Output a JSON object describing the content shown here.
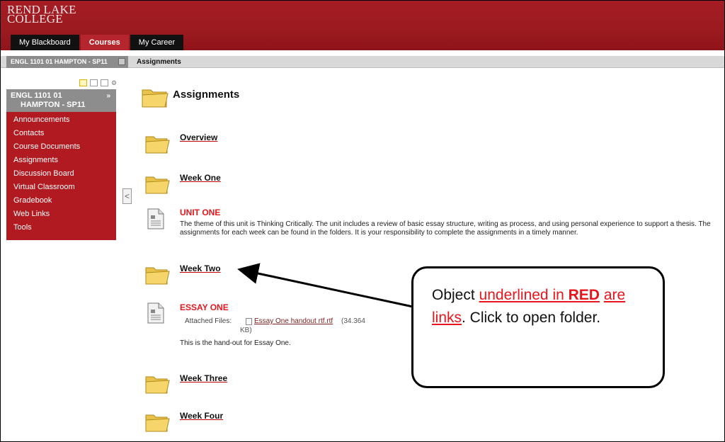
{
  "header": {
    "logo_line1": "REND LAKE",
    "logo_line2": "COLLEGE",
    "tabs": [
      {
        "label": "My Blackboard"
      },
      {
        "label": "Courses"
      },
      {
        "label": "My Career"
      }
    ],
    "active_tab": "Courses"
  },
  "breadcrumb": {
    "course": "ENGL 1101 01 HAMPTON - SP11",
    "current": "Assignments"
  },
  "course_menu": {
    "title_line1": "ENGL 1101 01",
    "title_line2": "HAMPTON - SP11",
    "arrows": "»",
    "items": [
      {
        "label": "Announcements"
      },
      {
        "label": "Contacts"
      },
      {
        "label": "Course Documents"
      },
      {
        "label": "Assignments"
      },
      {
        "label": "Discussion Board"
      },
      {
        "label": "Virtual Classroom"
      },
      {
        "label": "Gradebook"
      },
      {
        "label": "Web Links"
      },
      {
        "label": "Tools"
      }
    ],
    "collapse_glyph": "<"
  },
  "content": {
    "page_title": "Assignments",
    "items": [
      {
        "type": "folder",
        "title": "Overview"
      },
      {
        "type": "folder",
        "title": "Week One"
      },
      {
        "type": "item",
        "title": "UNIT ONE",
        "description": "The theme of this unit is Thinking Critically.  The unit includes a review of basic essay structure, writing as process, and using personal experience to support a thesis.  The assignments for each week can be found in the folders.  It is your responsibility to complete the assignments in a timely manner."
      },
      {
        "type": "folder",
        "title": "Week Two"
      },
      {
        "type": "item",
        "title": "ESSAY ONE",
        "attached_label": "Attached Files:",
        "attachment_name": "Essay One handout rtf.rtf",
        "attachment_size_a": "(34.364",
        "attachment_size_b": "KB)",
        "description": "This is the hand-out for Essay One."
      },
      {
        "type": "folder",
        "title": "Week Three"
      },
      {
        "type": "folder",
        "title": "Week Four"
      }
    ]
  },
  "callout": {
    "text_a": "Object ",
    "text_red_a": "underlined in ",
    "text_red_b": "RED",
    "text_red_c": "are links",
    "text_b": ". Click to open folder."
  },
  "colors": {
    "brand_red": "#a61c24",
    "menu_red": "#b01a20",
    "link_red": "#e8161c"
  }
}
